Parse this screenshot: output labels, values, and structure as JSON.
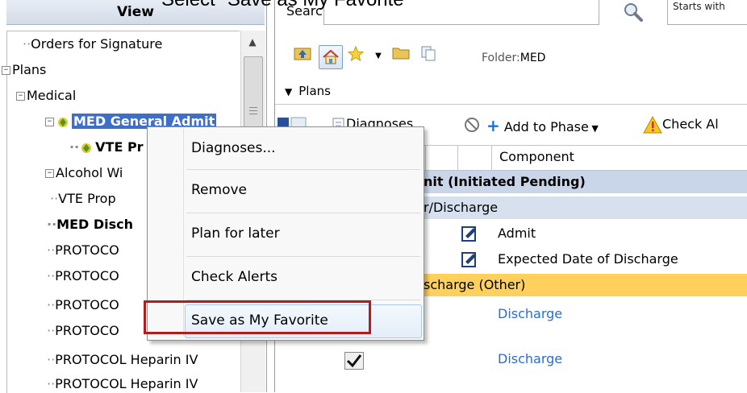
{
  "caption": "Select \"Save as My Favorite\"",
  "left_panel": {
    "header": "View",
    "tree": [
      {
        "label": "Orders for Signature",
        "indent": 0,
        "expander": "",
        "style": "normal"
      },
      {
        "label": "Plans",
        "indent": 0,
        "expander": "−",
        "style": "normal"
      },
      {
        "label": "Medical",
        "indent": 1,
        "expander": "−",
        "style": "normal"
      },
      {
        "label": "MED General Admit",
        "indent": 2,
        "expander": "−",
        "style": "selected"
      },
      {
        "label": "VTE Pr",
        "indent": 3,
        "expander": "",
        "style": "bold-icon"
      },
      {
        "label": "Alcohol Wi",
        "indent": 1,
        "expander": "−",
        "style": "normal"
      },
      {
        "label": "VTE Prop",
        "indent": 2,
        "expander": "",
        "style": "normal"
      },
      {
        "label": "MED Disch",
        "indent": 1,
        "expander": "",
        "style": "bold"
      },
      {
        "label": "PROTOCO",
        "indent": 1,
        "expander": "",
        "style": "normal"
      },
      {
        "label": "PROTOCO",
        "indent": 1,
        "expander": "",
        "style": "normal"
      },
      {
        "label": "PROTOCO",
        "indent": 1,
        "expander": "",
        "style": "normal"
      },
      {
        "label": "PROTOCO",
        "indent": 1,
        "expander": "",
        "style": "normal"
      },
      {
        "label": "PROTOCOL Heparin IV",
        "indent": 1,
        "expander": "",
        "style": "normal"
      },
      {
        "label": "PROTOCOL Heparin IV",
        "indent": 1,
        "expander": "",
        "style": "normal"
      }
    ]
  },
  "search": {
    "label": "Search:",
    "mode_value": "Starts with"
  },
  "toolbar": {
    "folder_label": "Folder:",
    "folder_value": "MED"
  },
  "plans_header": "Plans",
  "action_bar": {
    "diagnoses": "Diagnoses",
    "add_to_phase": "Add to Phase",
    "check_alerts": "Check Al"
  },
  "grid": {
    "column_component": "Component",
    "rows": [
      {
        "text": "nit (Initiated Pending)",
        "kind": "plan"
      },
      {
        "text": "r/Discharge",
        "kind": "sub"
      },
      {
        "text": "Admit",
        "kind": "order"
      },
      {
        "text": "Expected Date of Discharge",
        "kind": "order"
      },
      {
        "text": "scharge (Other)",
        "kind": "other"
      },
      {
        "text": "Discharge",
        "kind": "link"
      },
      {
        "text": "Discharge",
        "kind": "link"
      }
    ]
  },
  "context_menu": {
    "items": [
      "Diagnoses...",
      "Remove",
      "Plan for later",
      "Check Alerts",
      "Save as My Favorite"
    ],
    "highlighted": "Save as My Favorite"
  },
  "colors": {
    "selection": "#3d6ec9",
    "plan_row": "#c9d6ea",
    "other_row": "#ffd05c",
    "link": "#2a6dcf",
    "annotation_red": "#b21c1c"
  }
}
